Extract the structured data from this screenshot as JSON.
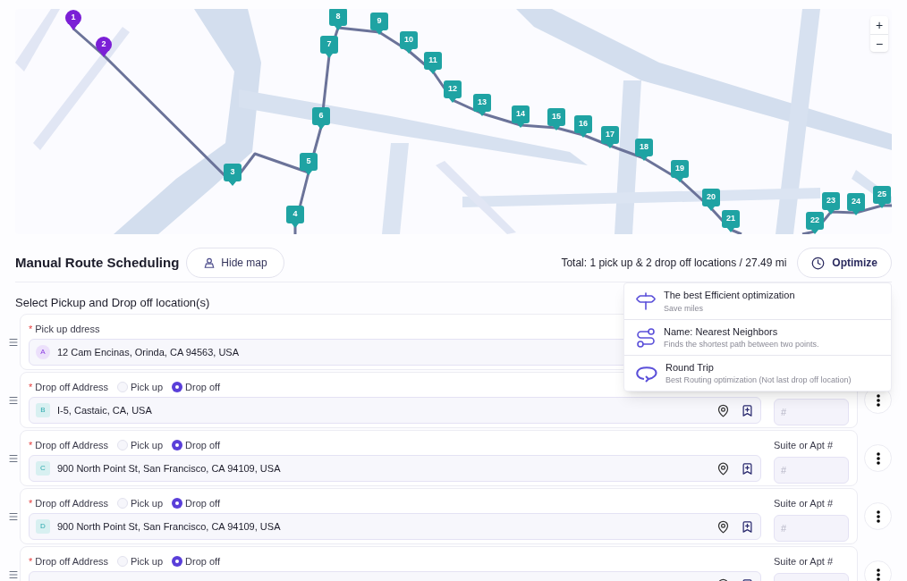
{
  "map": {
    "markers": [
      {
        "label": "1",
        "kind": "pickup"
      },
      {
        "label": "2",
        "kind": "pickup"
      },
      {
        "label": "3",
        "kind": "dropoff"
      },
      {
        "label": "4",
        "kind": "dropoff"
      },
      {
        "label": "5",
        "kind": "dropoff"
      },
      {
        "label": "6",
        "kind": "dropoff"
      },
      {
        "label": "7",
        "kind": "dropoff"
      },
      {
        "label": "8",
        "kind": "dropoff"
      },
      {
        "label": "9",
        "kind": "dropoff"
      },
      {
        "label": "10",
        "kind": "dropoff"
      },
      {
        "label": "11",
        "kind": "dropoff"
      },
      {
        "label": "12",
        "kind": "dropoff"
      },
      {
        "label": "13",
        "kind": "dropoff"
      },
      {
        "label": "14",
        "kind": "dropoff"
      },
      {
        "label": "15",
        "kind": "dropoff"
      },
      {
        "label": "16",
        "kind": "dropoff"
      },
      {
        "label": "17",
        "kind": "dropoff"
      },
      {
        "label": "18",
        "kind": "dropoff"
      },
      {
        "label": "19",
        "kind": "dropoff"
      },
      {
        "label": "20",
        "kind": "dropoff"
      },
      {
        "label": "21",
        "kind": "dropoff"
      },
      {
        "label": "22",
        "kind": "dropoff"
      },
      {
        "label": "23",
        "kind": "dropoff"
      },
      {
        "label": "24",
        "kind": "dropoff"
      },
      {
        "label": "25",
        "kind": "dropoff"
      }
    ],
    "zoom_in": "+",
    "zoom_out": "−"
  },
  "header": {
    "title": "Manual Route Scheduling",
    "hide_map_button": "Hide map",
    "total": "Total: 1 pick up & 2 drop off locations / 27.49 mi",
    "optimize_button": "Optimize"
  },
  "section_title": "Select Pickup and Drop off location(s)",
  "stops": [
    {
      "kind": "pickup",
      "required_mark": "*",
      "label": "Pick up ddress",
      "letter": "A",
      "address": "12 Cam Encinas, Orinda, CA 94563, USA",
      "actions": false,
      "menu_button": false
    },
    {
      "kind": "dropoff",
      "required_mark": "*",
      "label": "Drop off Address",
      "options": [
        {
          "label": "Pick up",
          "selected": false
        },
        {
          "label": "Drop off",
          "selected": true
        }
      ],
      "letter": "B",
      "address": "I-5, Castaic, CA, USA",
      "suite_placeholder": "#",
      "actions": true,
      "menu_button": true
    },
    {
      "kind": "dropoff",
      "required_mark": "*",
      "label": "Drop off Address",
      "options": [
        {
          "label": "Pick up",
          "selected": false
        },
        {
          "label": "Drop off",
          "selected": true
        }
      ],
      "letter": "C",
      "address": "900 North Point St, San Francisco, CA 94109, USA",
      "suite_label": "Suite or Apt #",
      "suite_placeholder": "#",
      "actions": true,
      "menu_button": true
    },
    {
      "kind": "dropoff",
      "required_mark": "*",
      "label": "Drop off Address",
      "options": [
        {
          "label": "Pick up",
          "selected": false
        },
        {
          "label": "Drop off",
          "selected": true
        }
      ],
      "letter": "D",
      "address": "900 North Point St, San Francisco, CA 94109, USA",
      "suite_label": "Suite or Apt #",
      "suite_placeholder": "#",
      "actions": true,
      "menu_button": true
    },
    {
      "kind": "dropoff",
      "required_mark": "*",
      "label": "Drop off Address",
      "options": [
        {
          "label": "Pick up",
          "selected": false
        },
        {
          "label": "Drop off",
          "selected": true
        }
      ],
      "suite_label": "Suite or Apt #",
      "actions": true,
      "menu_button": true
    }
  ],
  "optimize_menu": [
    {
      "title": "The best Efficient optimization",
      "subtitle": "Save miles"
    },
    {
      "title": "Name: Nearest Neighbors",
      "subtitle": "Finds the shortest path between two points."
    },
    {
      "title": "Round Trip",
      "subtitle": "Best Routing optimization (Not last drop off location)"
    }
  ]
}
